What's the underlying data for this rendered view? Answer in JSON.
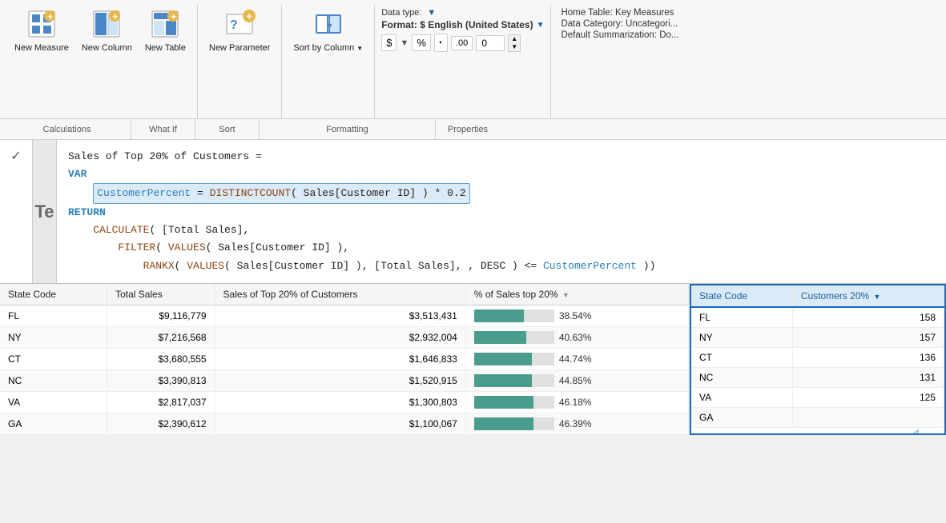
{
  "toolbar": {
    "groups": {
      "calculations": {
        "label": "Calculations",
        "buttons": [
          {
            "id": "new-measure",
            "label": "New\nMeasure",
            "icon": "⊞"
          },
          {
            "id": "new-column",
            "label": "New\nColumn",
            "icon": "⊟"
          },
          {
            "id": "new-table",
            "label": "New\nTable",
            "icon": "⊠"
          }
        ]
      },
      "whatif": {
        "label": "What If",
        "buttons": [
          {
            "id": "new-parameter",
            "label": "New\nParameter",
            "icon": "⊕"
          }
        ]
      },
      "sort": {
        "label": "Sort",
        "buttons": [
          {
            "id": "sort-by-column",
            "label": "Sort by\nColumn",
            "icon": "⇅"
          }
        ]
      },
      "formatting": {
        "label": "Formatting",
        "datatype_label": "Data type:",
        "format_label": "Format: $ English (United States)",
        "format_dropdown": true,
        "currency_btn": "$",
        "percent_btn": "%",
        "decimal_btn": ".",
        "decimal_places": "0"
      },
      "properties": {
        "label": "Properties",
        "home_table": "Home Table: Key Measures",
        "data_category": "Data Category: Uncategori...",
        "default_summarization": "Default Summarization: Do..."
      }
    }
  },
  "formula_bar": {
    "measure_name": "Sales of Top 20% of Customers =",
    "lines": [
      {
        "type": "keyword",
        "text": "VAR"
      },
      {
        "type": "highlighted",
        "text": "    CustomerPercent = DISTINCTCOUNT( Sales[Customer ID] ) * 0.2"
      },
      {
        "type": "keyword",
        "text": "RETURN"
      },
      {
        "type": "normal",
        "text": "    CALCULATE( [Total Sales],"
      },
      {
        "type": "normal",
        "text": "        FILTER( VALUES( Sales[Customer ID] ),"
      },
      {
        "type": "normal",
        "text": "            RANKX( VALUES( Sales[Customer ID] ), [Total Sales], , DESC ) <= CustomerPercent ))"
      }
    ]
  },
  "left_table": {
    "columns": [
      {
        "id": "state-code",
        "label": "State Code"
      },
      {
        "id": "total-sales",
        "label": "Total Sales"
      },
      {
        "id": "sales-top20",
        "label": "Sales of Top 20% of Customers"
      },
      {
        "id": "pct-top20",
        "label": "% of Sales top 20%"
      }
    ],
    "rows": [
      {
        "state": "FL",
        "total_sales": "$9,116,779",
        "sales_top20": "$3,513,431",
        "pct": 38.54,
        "pct_label": "38.54%"
      },
      {
        "state": "NY",
        "total_sales": "$7,216,568",
        "sales_top20": "$2,932,004",
        "pct": 40.63,
        "pct_label": "40.63%"
      },
      {
        "state": "CT",
        "total_sales": "$3,680,555",
        "sales_top20": "$1,646,833",
        "pct": 44.74,
        "pct_label": "44.74%"
      },
      {
        "state": "NC",
        "total_sales": "$3,390,813",
        "sales_top20": "$1,520,915",
        "pct": 44.85,
        "pct_label": "44.85%"
      },
      {
        "state": "VA",
        "total_sales": "$2,817,037",
        "sales_top20": "$1,300,803",
        "pct": 46.18,
        "pct_label": "46.18%"
      },
      {
        "state": "GA",
        "total_sales": "$2,390,612",
        "sales_top20": "$1,100,067",
        "pct": 46.39,
        "pct_label": "46.39%"
      }
    ]
  },
  "right_table": {
    "columns": [
      {
        "id": "state-code-r",
        "label": "State Code"
      },
      {
        "id": "customers-20",
        "label": "Customers 20%"
      }
    ],
    "rows": [
      {
        "state": "FL",
        "customers": "158"
      },
      {
        "state": "NY",
        "customers": "157"
      },
      {
        "state": "CT",
        "customers": "136"
      },
      {
        "state": "NC",
        "customers": "131"
      },
      {
        "state": "VA",
        "customers": "125"
      },
      {
        "state": "GA",
        "customers": ""
      }
    ]
  },
  "icons": {
    "check": "✓",
    "dropdown_arrow": "▼",
    "sort_arrow": "▼",
    "spinner_up": "▲",
    "spinner_down": "▼"
  }
}
